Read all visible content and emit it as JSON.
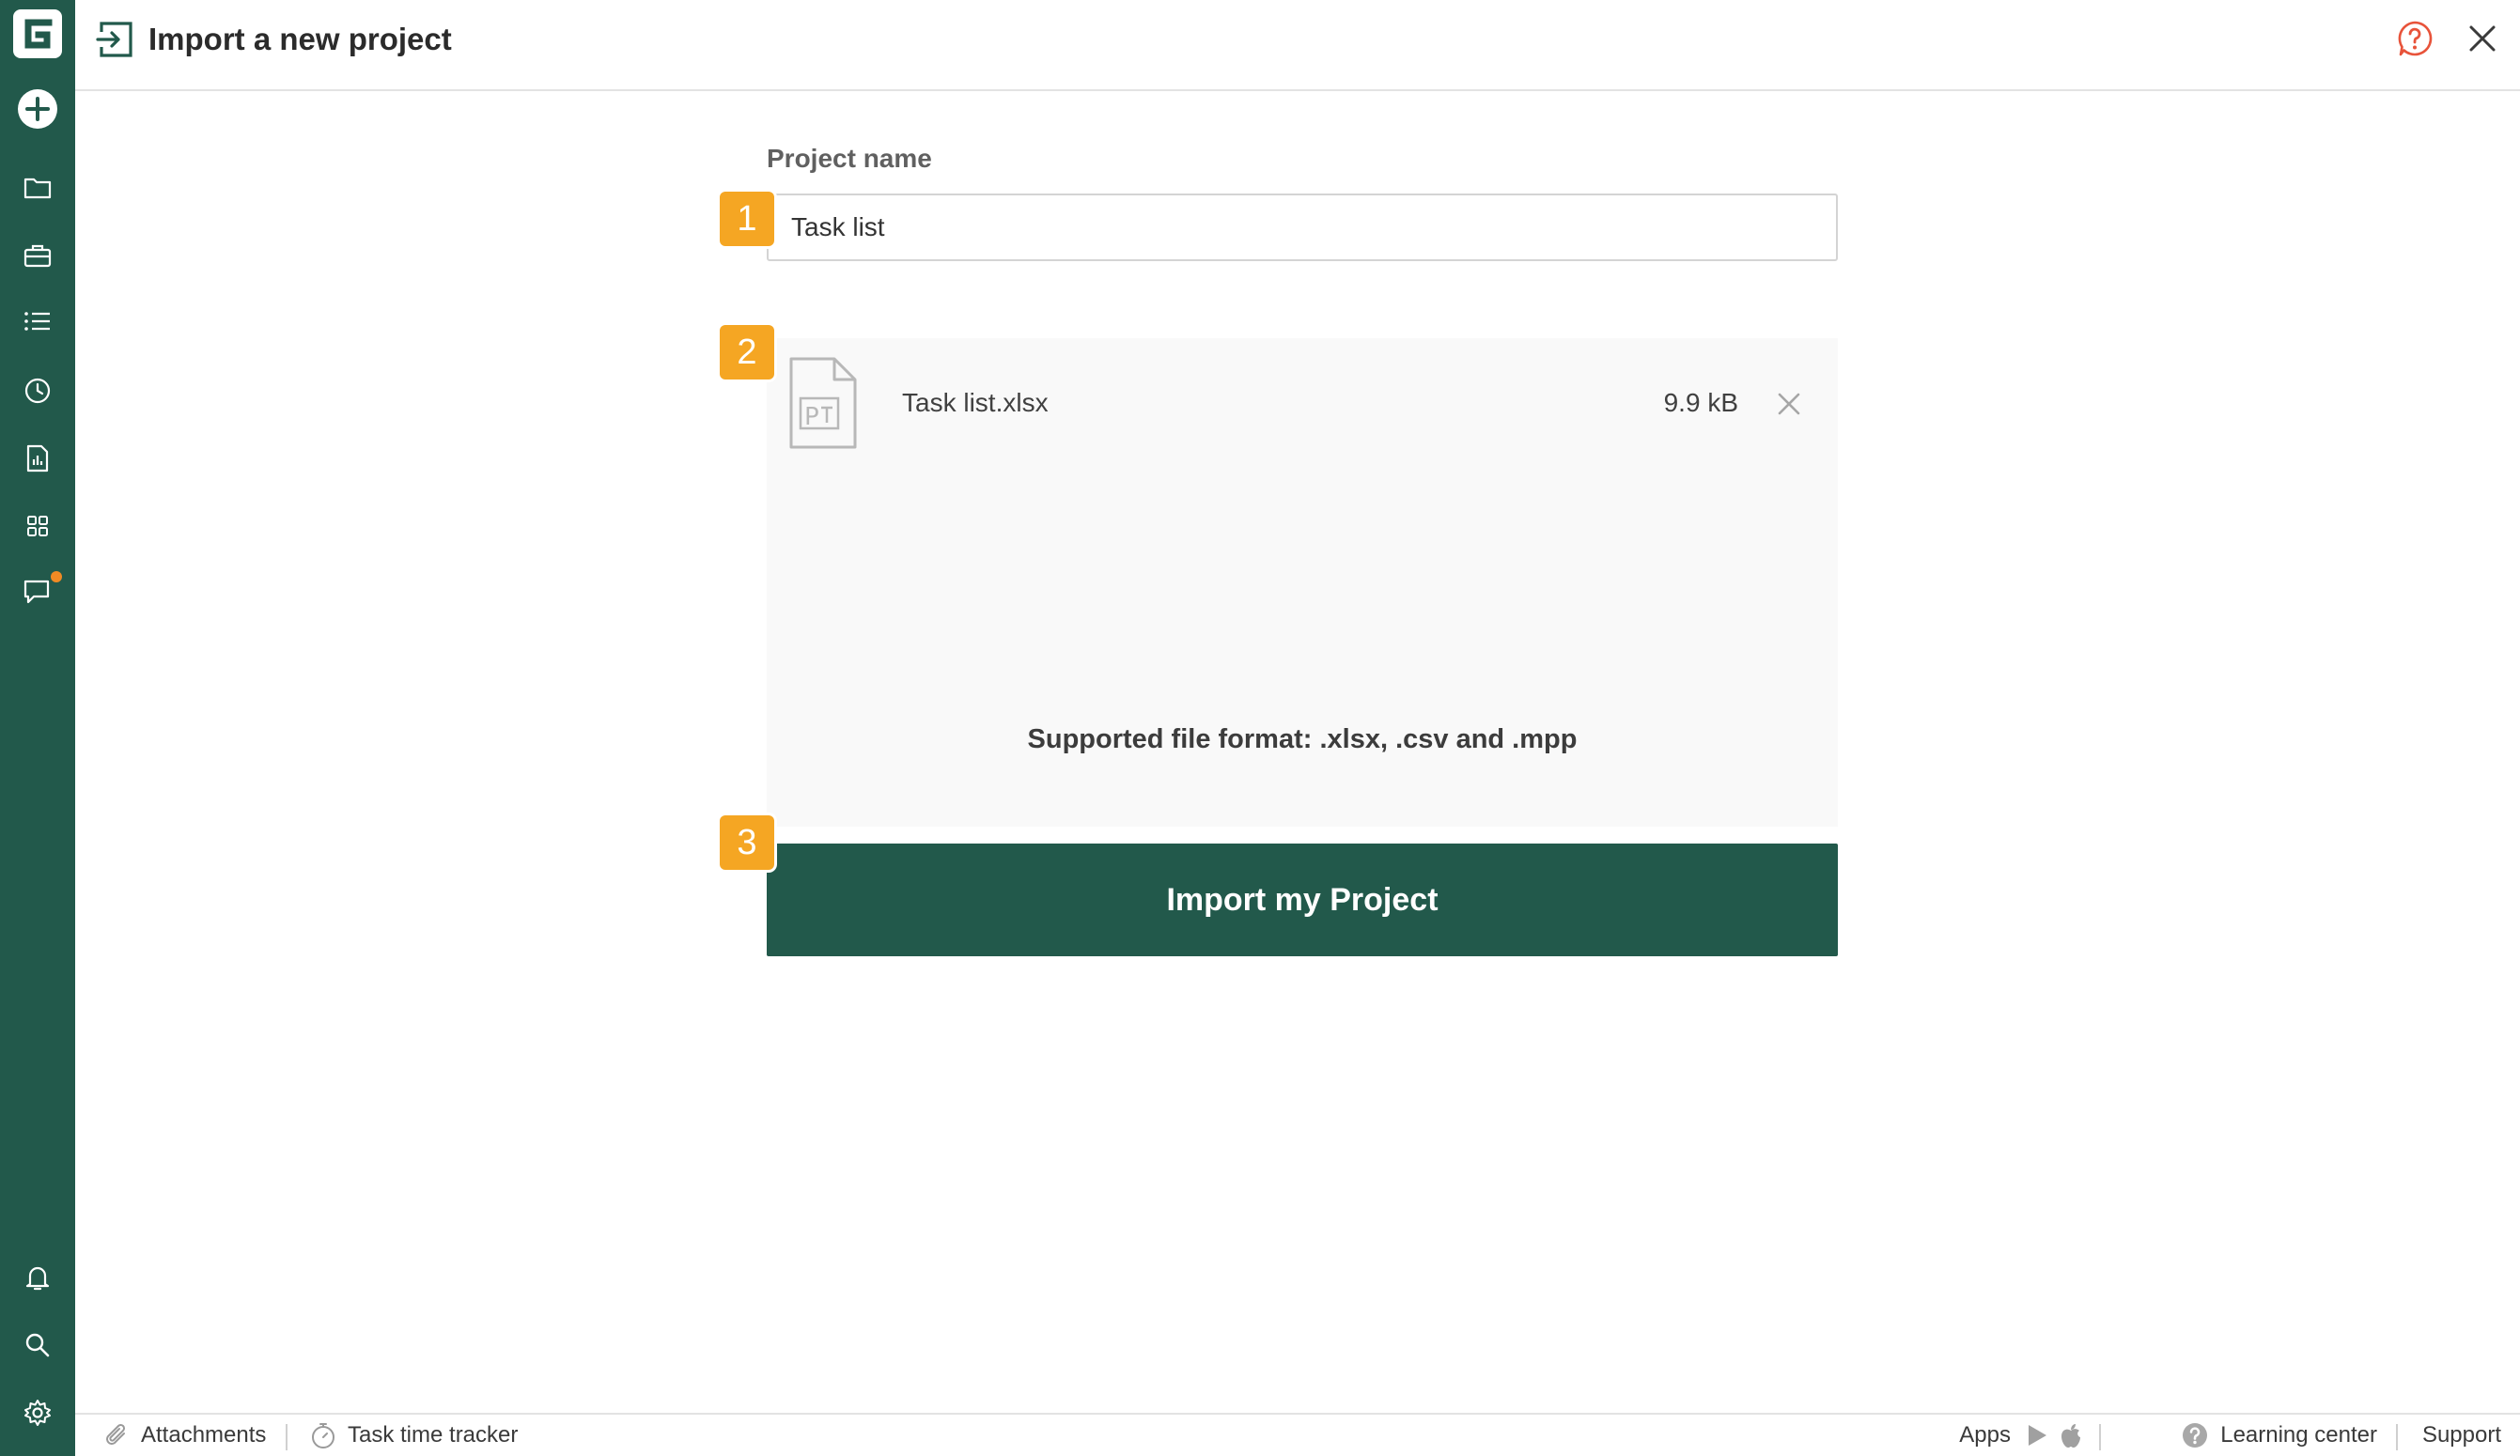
{
  "header": {
    "title": "Import a new project"
  },
  "form": {
    "project_name_label": "Project name",
    "project_name_value": "Task list",
    "file": {
      "name": "Task list.xlsx",
      "size": "9.9 kB"
    },
    "supported_formats": "Supported file format: .xlsx, .csv and .mpp",
    "import_button": "Import my Project",
    "steps": [
      "1",
      "2",
      "3"
    ]
  },
  "footer": {
    "attachments": "Attachments",
    "time_tracker": "Task time tracker",
    "apps": "Apps",
    "learning_center": "Learning center",
    "support": "Support"
  },
  "colors": {
    "brand": "#22594b",
    "step_badge": "#f5a623",
    "notification": "#f08a24",
    "help": "#e8533a"
  },
  "sidebar": {
    "icons": [
      "add-icon",
      "folder-icon",
      "briefcase-icon",
      "list-icon",
      "clock-icon",
      "report-icon",
      "apps-grid-icon",
      "chat-icon",
      "bell-icon",
      "search-icon",
      "gear-icon"
    ]
  }
}
